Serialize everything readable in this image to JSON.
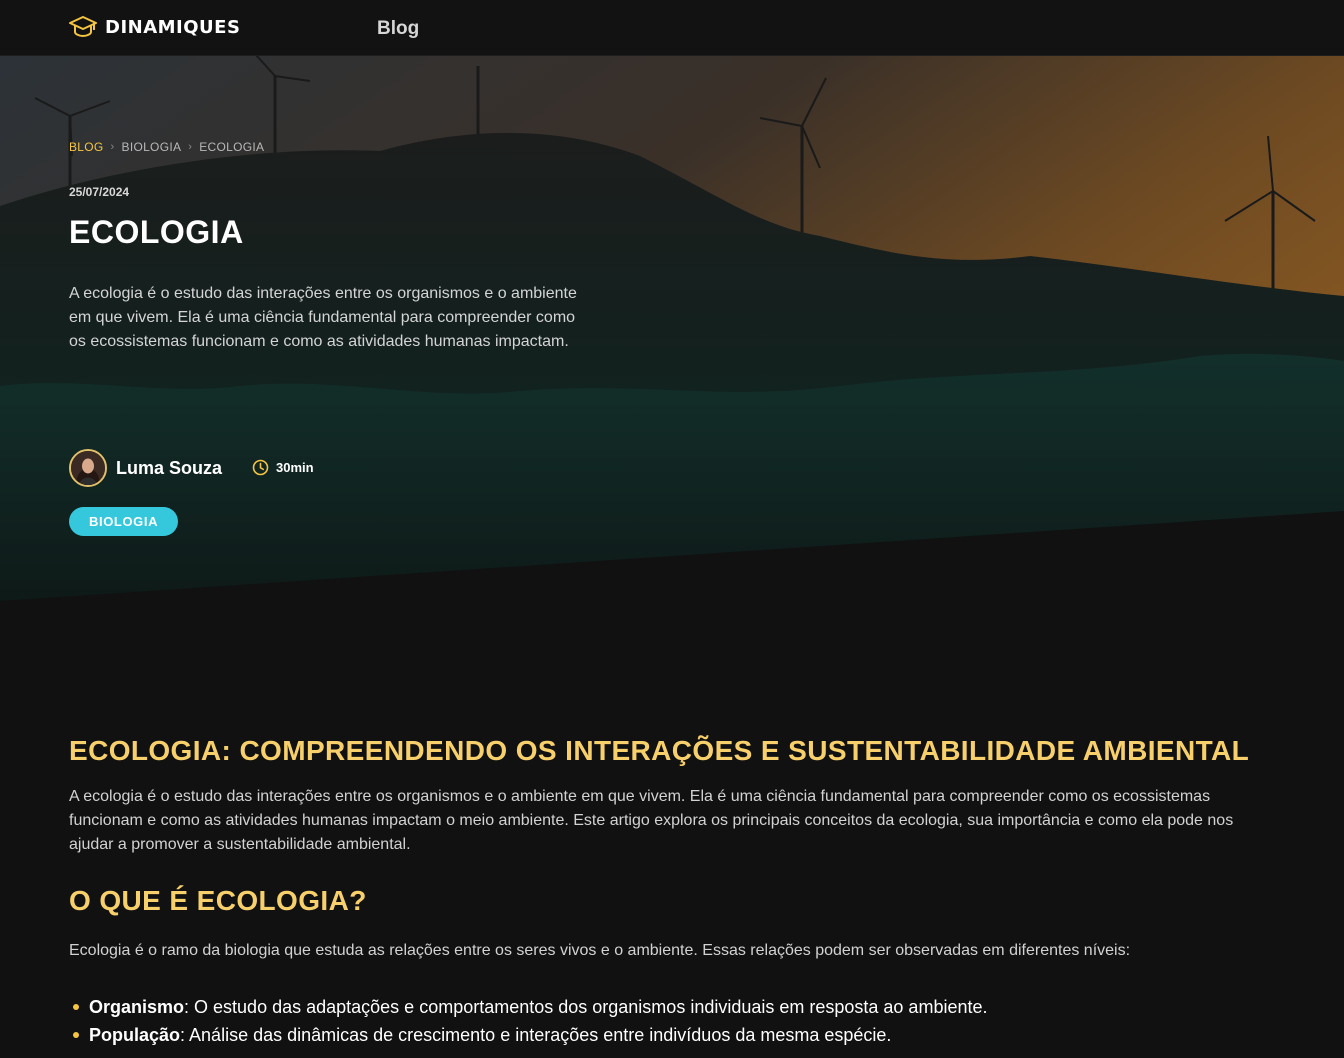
{
  "header": {
    "logo_text": "DINAMIQUES",
    "nav_blog": "Blog"
  },
  "breadcrumb": [
    "BLOG",
    "BIOLOGIA",
    "ECOLOGIA"
  ],
  "article": {
    "date": "25/07/2024",
    "title": "ECOLOGIA",
    "lead": "A ecologia é o estudo das interações entre os organismos e o ambiente em que vivem. Ela é uma ciência fundamental para compreender como os ecossistemas funcionam e como as atividades humanas impactam.",
    "author": "Luma Souza",
    "read_time": "30min",
    "tag": "BIOLOGIA"
  },
  "content": {
    "heading": "ECOLOGIA: COMPREENDENDO OS INTERAÇÕES E SUSTENTABILIDADE AMBIENTAL",
    "intro": "A ecologia é o estudo das interações entre os organismos e o ambiente em que vivem. Ela é uma ciência fundamental para compreender como os ecossistemas funcionam e como as atividades humanas impactam o meio ambiente. Este artigo explora os principais conceitos da ecologia, sua importância e como ela pode nos ajudar a promover a sustentabilidade ambiental.",
    "subheading": "O QUE É ECOLOGIA?",
    "paragraph": "Ecologia é o ramo da biologia que estuda as relações entre os seres vivos e o ambiente. Essas relações podem ser observadas em diferentes níveis:",
    "levels": [
      {
        "term": "Organismo",
        "desc": ": O estudo das adaptações e comportamentos dos organismos individuais em resposta ao ambiente."
      },
      {
        "term": "População",
        "desc": ": Análise das dinâmicas de crescimento e interações entre indivíduos da mesma espécie."
      }
    ]
  },
  "colors": {
    "accent": "#f7d06b",
    "tag_bg": "#35c8dd",
    "background": "#111111"
  },
  "icons": [
    "graduation-cap-icon",
    "chevron-right-icon",
    "clock-icon"
  ]
}
